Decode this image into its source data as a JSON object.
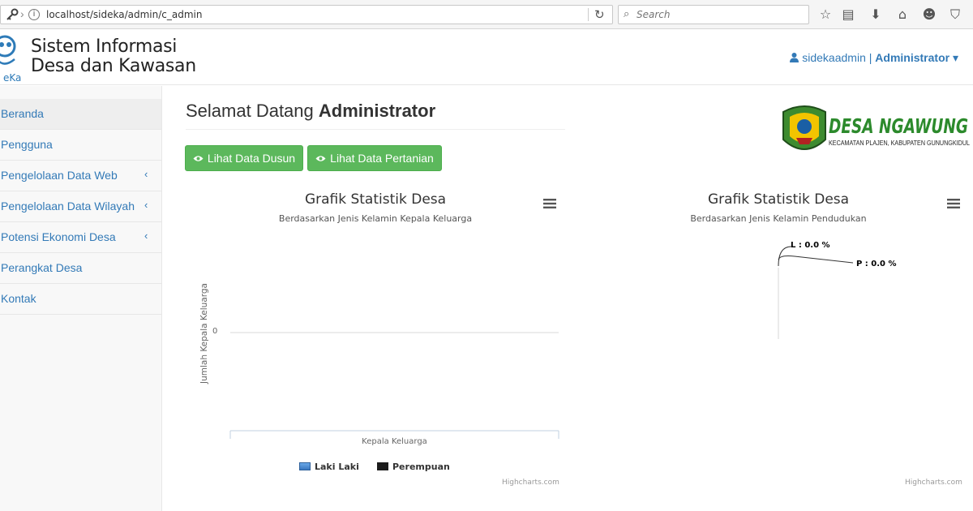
{
  "browser": {
    "url": "localhost/sideka/admin/c_admin",
    "search_placeholder": "Search"
  },
  "header": {
    "logo_text": "eKa",
    "brand_line1": "Sistem Informasi",
    "brand_line2": "Desa dan Kawasan",
    "user_name": "sidekaadmin",
    "user_sep": "|",
    "user_role": "Administrator"
  },
  "sidebar": {
    "items": [
      {
        "label": "Beranda"
      },
      {
        "label": "Pengguna"
      },
      {
        "label": "Pengelolaan Data Web"
      },
      {
        "label": "Pengelolaan Data Wilayah"
      },
      {
        "label": "Potensi Ekonomi Desa"
      },
      {
        "label": "Perangkat Desa"
      },
      {
        "label": "Kontak"
      }
    ]
  },
  "main": {
    "welcome_prefix": "Selamat Datang",
    "welcome_name": "Administrator",
    "btn_dusun": "Lihat Data Dusun",
    "btn_pertanian": "Lihat Data Pertanian",
    "desa_name": "DESA NGAWUNG",
    "desa_sub": "KECAMATAN PLAJEN, KABUPATEN GUNUNGKIDUL"
  },
  "colors": {
    "accent": "#337ab7",
    "button_green": "#5cb85c",
    "laki_laki": "#4a8ed3",
    "perempuan": "#1c1c1c"
  },
  "chart_data": [
    {
      "type": "bar",
      "title": "Grafik Statistik Desa",
      "subtitle": "Berdasarkan Jenis Kelamin Kepala Keluarga",
      "xlabel": "Kepala Keluarga",
      "ylabel": "Jumlah Kepala Keluarga",
      "y_ticks": [
        "0"
      ],
      "series": [
        {
          "name": "Laki Laki",
          "values": [
            0
          ]
        },
        {
          "name": "Perempuan",
          "values": [
            0
          ]
        }
      ],
      "legend": "bottom",
      "credits": "Highcharts.com"
    },
    {
      "type": "pie",
      "title": "Grafik Statistik Desa",
      "subtitle": "Berdasarkan Jenis Kelamin Pendudukan",
      "slices": [
        {
          "label": "L : 0.0 %",
          "value": 0
        },
        {
          "label": "P : 0.0 %",
          "value": 0
        }
      ],
      "credits": "Highcharts.com"
    }
  ]
}
